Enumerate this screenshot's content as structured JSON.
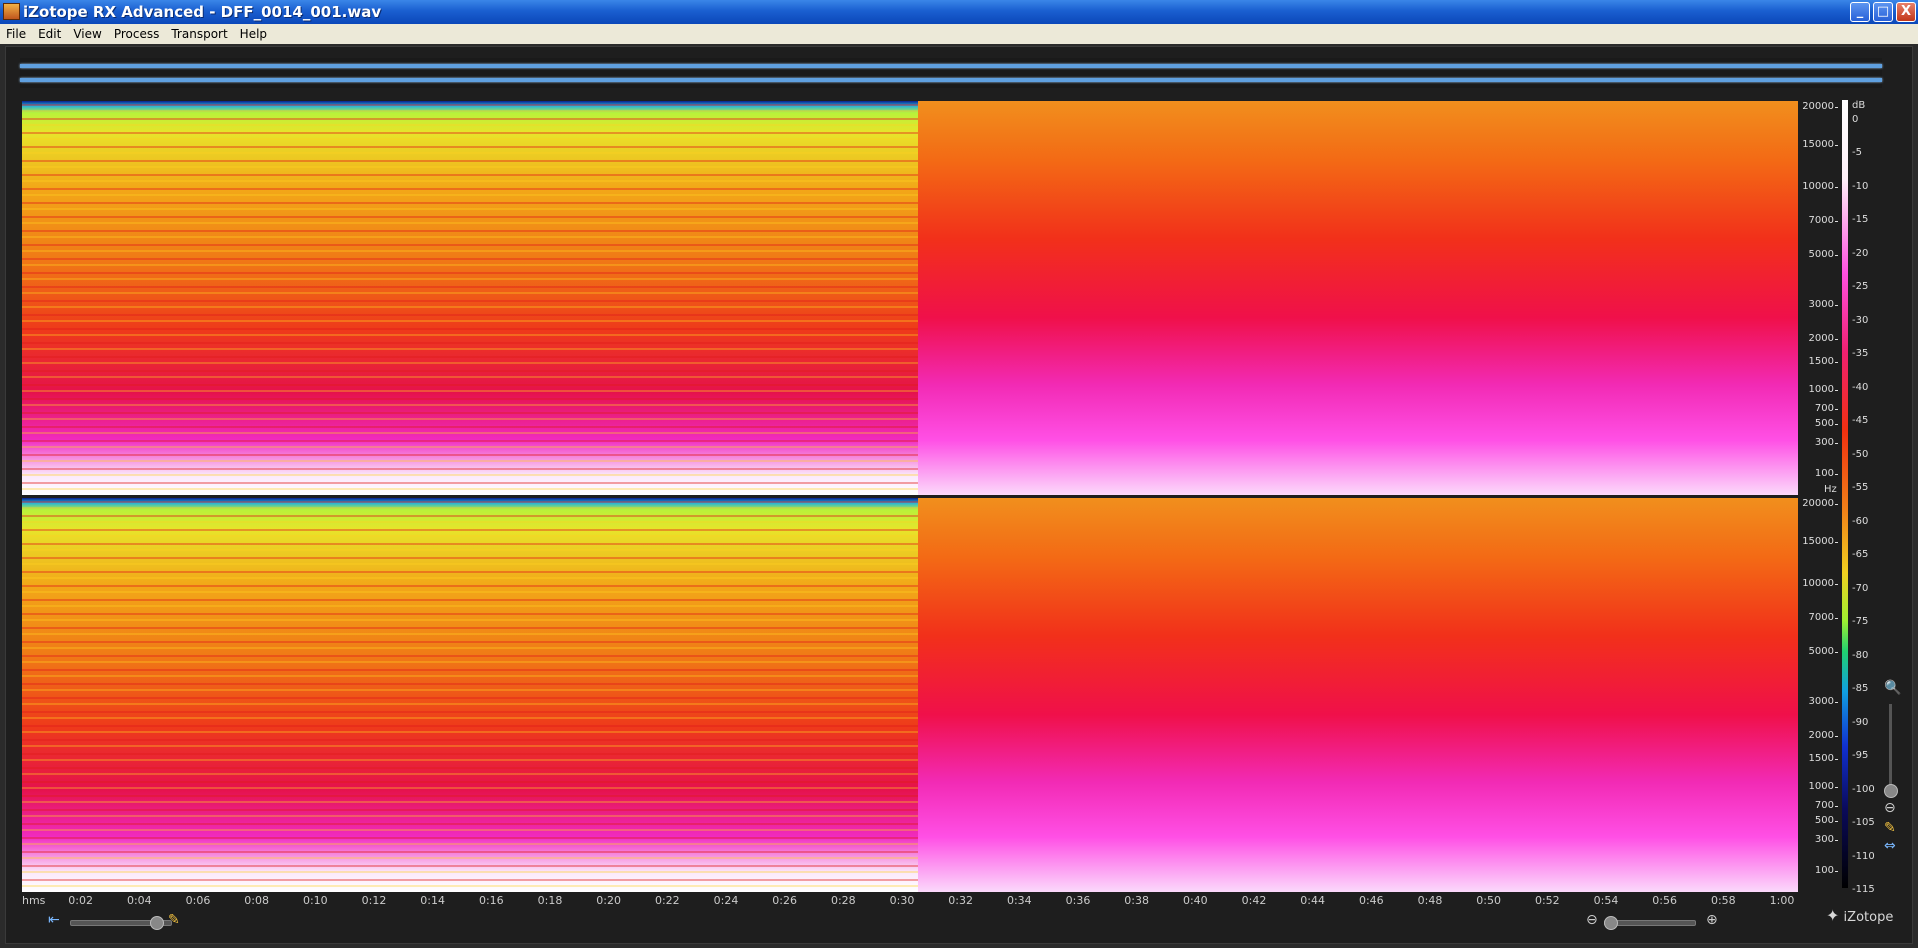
{
  "window": {
    "title": "iZotope RX Advanced - DFF_0014_001.wav",
    "buttons": {
      "minimize": "_",
      "maximize": "□",
      "close": "X"
    }
  },
  "menu": [
    "File",
    "Edit",
    "View",
    "Process",
    "Transport",
    "Help"
  ],
  "spectrogram": {
    "freq_unit": "Hz",
    "freq_ticks": [
      {
        "label": "20000",
        "pos": 0.0
      },
      {
        "label": "15000",
        "pos": 0.1
      },
      {
        "label": "10000",
        "pos": 0.21
      },
      {
        "label": "7000",
        "pos": 0.3
      },
      {
        "label": "5000",
        "pos": 0.39
      },
      {
        "label": "3000",
        "pos": 0.52
      },
      {
        "label": "2000",
        "pos": 0.61
      },
      {
        "label": "1500",
        "pos": 0.67
      },
      {
        "label": "1000",
        "pos": 0.745
      },
      {
        "label": "700",
        "pos": 0.795
      },
      {
        "label": "500",
        "pos": 0.835
      },
      {
        "label": "300",
        "pos": 0.885
      },
      {
        "label": "100",
        "pos": 0.965
      }
    ],
    "db_unit": "dB",
    "db_ticks": [
      "0",
      "-5",
      "-10",
      "-15",
      "-20",
      "-25",
      "-30",
      "-35",
      "-40",
      "-45",
      "-50",
      "-55",
      "-60",
      "-65",
      "-70",
      "-75",
      "-80",
      "-85",
      "-90",
      "-95",
      "-100",
      "-105",
      "-110",
      "-115"
    ],
    "time_unit": "hms",
    "time_ticks": [
      "0:02",
      "0:04",
      "0:06",
      "0:08",
      "0:10",
      "0:12",
      "0:14",
      "0:16",
      "0:18",
      "0:20",
      "0:22",
      "0:24",
      "0:26",
      "0:28",
      "0:30",
      "0:32",
      "0:34",
      "0:36",
      "0:38",
      "0:40",
      "0:42",
      "0:44",
      "0:46",
      "0:48",
      "0:50",
      "0:52",
      "0:54",
      "0:56",
      "0:58",
      "1:00"
    ]
  },
  "logo": "iZotope"
}
